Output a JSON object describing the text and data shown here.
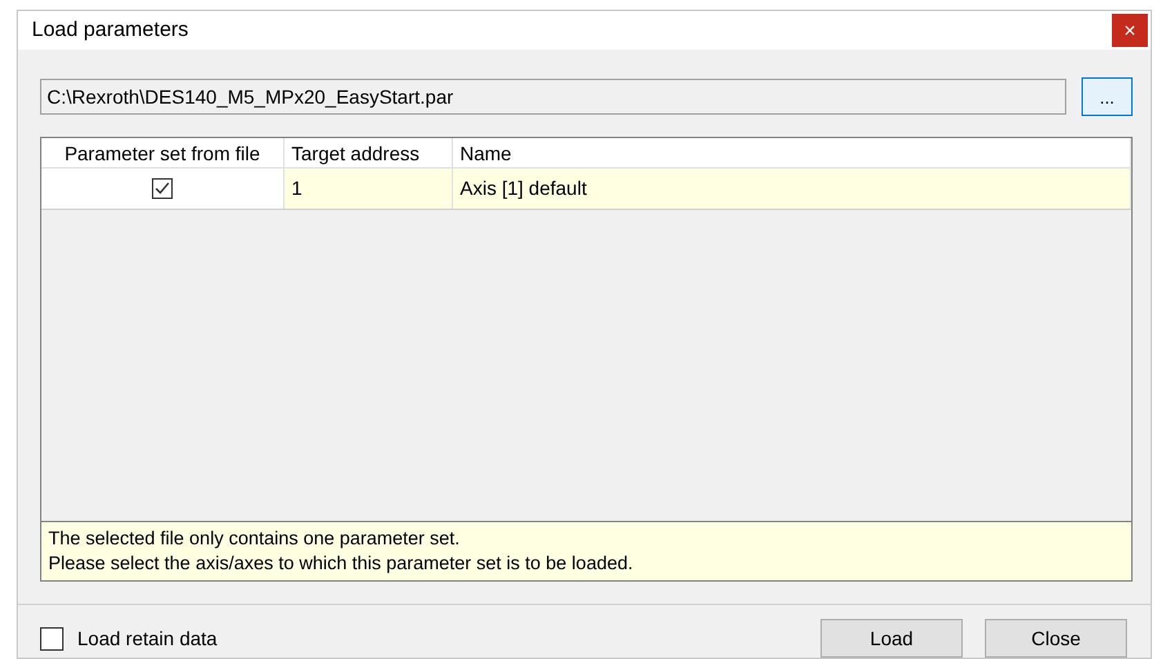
{
  "window": {
    "title": "Load parameters",
    "close": "×"
  },
  "file": {
    "value": "C:\\Rexroth\\DES140_M5_MPx20_EasyStart.par",
    "browse": "..."
  },
  "table": {
    "columns": [
      "Parameter set from file",
      "Target address",
      "Name"
    ],
    "rows": [
      {
        "checked": true,
        "selected": true,
        "address": "1",
        "name": "Axis [1] default"
      }
    ]
  },
  "info": [
    "The selected file only contains one parameter set.",
    "Please select the axis/axes to which this parameter set is to be loaded."
  ],
  "retain": {
    "label": "Load retain data",
    "checked": false
  },
  "buttons": [
    "Load",
    "Close"
  ]
}
